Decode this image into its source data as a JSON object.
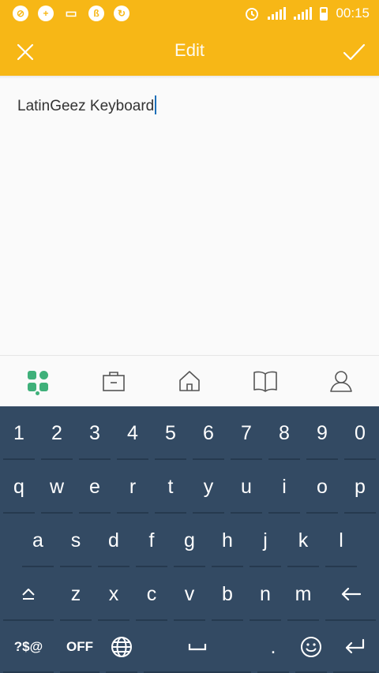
{
  "status_bar": {
    "time": "00:15",
    "icons": [
      "no-entry-icon",
      "plus-circle-icon",
      "battery-saver-icon",
      "bluetooth-badge-icon",
      "sync-icon",
      "alarm-icon",
      "signal-icon",
      "signal-icon",
      "battery-icon"
    ]
  },
  "app_bar": {
    "title": "Edit",
    "close_icon": "close-icon",
    "confirm_icon": "check-icon",
    "color": "#f7b716"
  },
  "editor": {
    "text": "LatinGeez Keyboard"
  },
  "bottom_nav": {
    "items": [
      "apps-grid-icon",
      "briefcase-icon",
      "home-icon",
      "book-icon",
      "user-icon"
    ],
    "active_color": "#3fb07a"
  },
  "keyboard": {
    "background": "#334a63",
    "row1": [
      "1",
      "2",
      "3",
      "4",
      "5",
      "6",
      "7",
      "8",
      "9",
      "0"
    ],
    "row2": [
      "q",
      "w",
      "e",
      "r",
      "t",
      "y",
      "u",
      "i",
      "o",
      "p"
    ],
    "row3": [
      "a",
      "s",
      "d",
      "f",
      "g",
      "h",
      "j",
      "k",
      "l"
    ],
    "row4": [
      "z",
      "x",
      "c",
      "v",
      "b",
      "n",
      "m"
    ],
    "symbols_label": "?$@",
    "off_label": "OFF",
    "period_label": "."
  }
}
